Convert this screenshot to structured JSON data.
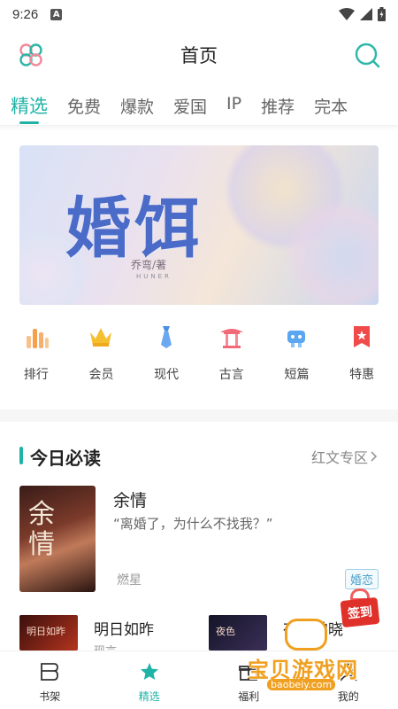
{
  "status_bar": {
    "time": "9:26",
    "notif_icon": "A"
  },
  "header": {
    "title": "首页",
    "menu_icon": "grid-flower-icon",
    "search_icon": "search-icon"
  },
  "tabs": [
    {
      "label": "精选",
      "active": true
    },
    {
      "label": "免费"
    },
    {
      "label": "爆款"
    },
    {
      "label": "爱国"
    },
    {
      "label": "IP"
    },
    {
      "label": "推荐"
    },
    {
      "label": "完本"
    }
  ],
  "banner": {
    "title": "婚饵",
    "author": "乔弯/著",
    "subtitle": "HUNER"
  },
  "categories": [
    {
      "label": "排行",
      "icon": "bar-chart-icon",
      "color": "#f5a04a"
    },
    {
      "label": "会员",
      "icon": "crown-icon",
      "color": "#f5c030"
    },
    {
      "label": "现代",
      "icon": "tie-icon",
      "color": "#4a8ee8"
    },
    {
      "label": "古言",
      "icon": "pavilion-icon",
      "color": "#f26a7a"
    },
    {
      "label": "短篇",
      "icon": "robot-icon",
      "color": "#5aa6f0"
    },
    {
      "label": "特惠",
      "icon": "discount-tag-icon",
      "color": "#f04a4a"
    }
  ],
  "today_section": {
    "title": "今日必读",
    "more": "红文专区"
  },
  "featured_book": {
    "cover_text": "余情",
    "name": "余情",
    "desc": "“离婚了，为什么不找我？”",
    "author": "燃星",
    "tag": "婚恋"
  },
  "row_books": [
    {
      "cover_text": "明日如昨",
      "name": "明日如昨",
      "sub": "现言"
    },
    {
      "cover_text": "夜色",
      "name": "夜色拂晓"
    }
  ],
  "signin_badge": {
    "label": "签到"
  },
  "bottom_nav": [
    {
      "label": "书架",
      "icon": "bookshelf-icon",
      "active": false
    },
    {
      "label": "精选",
      "icon": "star-icon",
      "active": true
    },
    {
      "label": "福利",
      "icon": "gift-icon",
      "active": false
    },
    {
      "label": "我的",
      "icon": "profile-icon",
      "active": false
    }
  ],
  "watermark": {
    "text": "宝贝游戏网",
    "url": "baobeiy.com"
  },
  "colors": {
    "accent": "#1fb3a6"
  }
}
